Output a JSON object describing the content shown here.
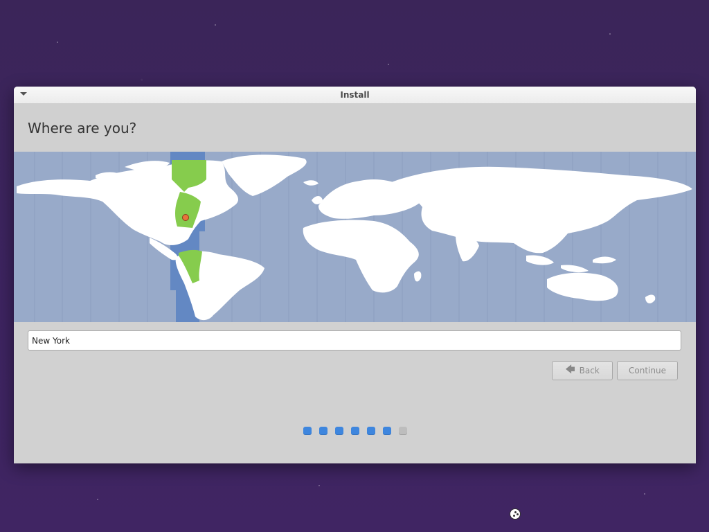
{
  "window": {
    "title": "Install"
  },
  "page": {
    "heading": "Where are you?"
  },
  "location": {
    "value": "New York"
  },
  "buttons": {
    "back_label": "Back",
    "continue_label": "Continue"
  },
  "progress": {
    "total_steps": 7,
    "completed_steps": 6
  },
  "colors": {
    "ocean": "#98aac9",
    "land": "#ffffff",
    "selected_timezone_band": "#5d84c2",
    "selected_timezone_land": "#86cc4d",
    "step_active": "#3e86de",
    "step_inactive": "#bdbdbd"
  }
}
